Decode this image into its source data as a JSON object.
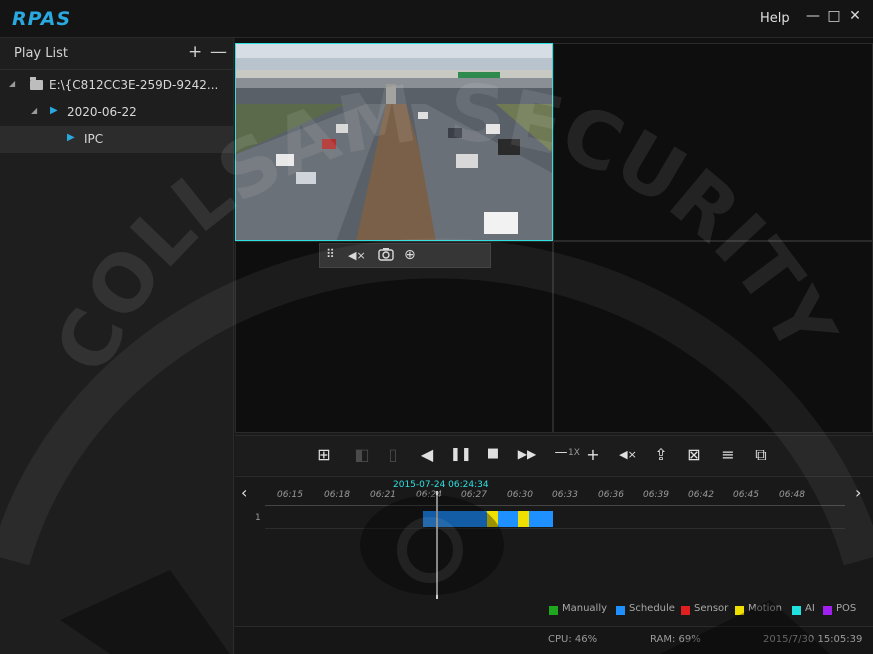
{
  "app": {
    "logo": "RPAS",
    "help": "Help"
  },
  "window_controls": {
    "minimize": "—",
    "restore": "□",
    "close": "✕"
  },
  "playlist": {
    "title": "Play List",
    "add": "+",
    "remove": "—",
    "tree": [
      {
        "label": "E:\\{C812CC3E-259D-9242...",
        "icon": "folder-icon"
      },
      {
        "label": "2020-06-22",
        "icon": "play-triangle-icon"
      },
      {
        "label": "IPC",
        "icon": "play-triangle-icon"
      }
    ]
  },
  "view_toolbar": {
    "icons": [
      "drag-handle-icon",
      "mute-icon",
      "snapshot-icon",
      "zoom-in-icon"
    ],
    "glyphs": [
      "⠿",
      "◀×",
      "📷",
      "⊕"
    ]
  },
  "controls": {
    "speed_label": "1X",
    "glyphs": {
      "layout": "⊞",
      "prev_frame": "◧",
      "next_frame": "▯",
      "rewind": "◀",
      "pause": "❚❚",
      "stop": "■",
      "fast_forward": "▶▶",
      "slower": "—",
      "faster": "+",
      "mute": "◀×",
      "export": "⇪",
      "clip": "⊠",
      "list": "≡",
      "multi_window": "⧉"
    }
  },
  "timeline": {
    "prev": "‹",
    "next": "›",
    "cursor_time": "2015-07-24 06:24:34",
    "row_label": "1",
    "ticks": [
      "06:15",
      "06:18",
      "06:21",
      "06:24",
      "06:27",
      "06:30",
      "06:33",
      "06:36",
      "06:39",
      "06:42",
      "06:45",
      "06:48"
    ],
    "legend": [
      "Manually",
      "Schedule",
      "Sensor",
      "Motion",
      "AI",
      "POS"
    ],
    "legend_colors": [
      "#1fa81f",
      "#1e90ff",
      "#e02020",
      "#f0e000",
      "#20e0e0",
      "#a020f0"
    ]
  },
  "status": {
    "cpu": "CPU: 46%",
    "ram": "RAM: 69%",
    "datetime": "2015/7/30 15:05:39"
  },
  "watermark": {
    "text": "COLLSAM SECURITY"
  }
}
